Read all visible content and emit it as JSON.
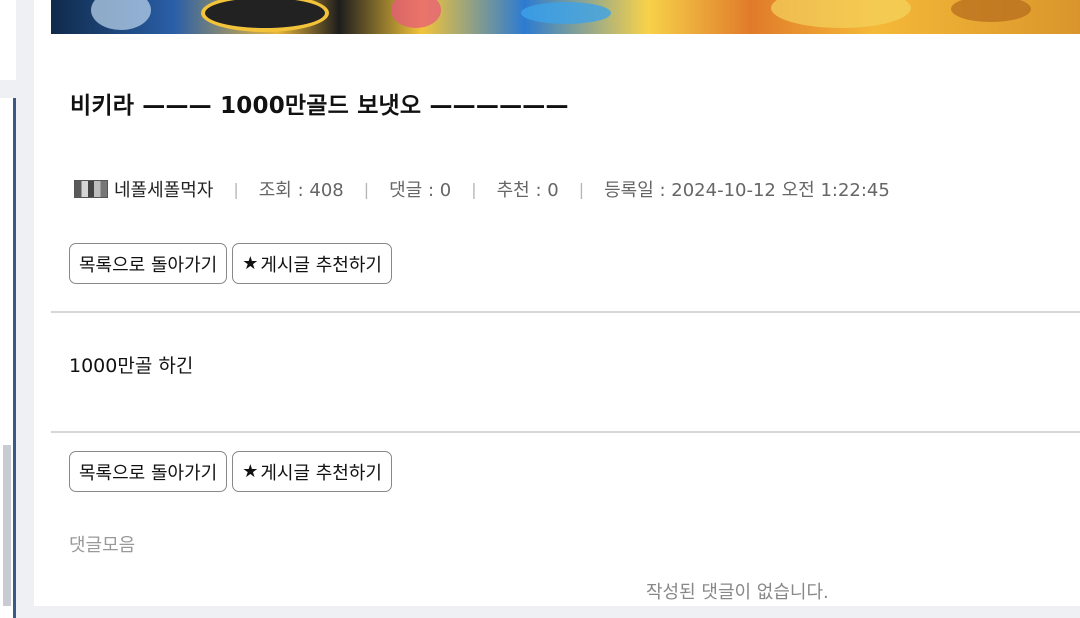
{
  "post": {
    "title": "비키라 ——— 1000만골드 보냇오 ——————",
    "author": "네폴세폴먹자",
    "views": "조회 : 408",
    "comments_count": "댓글 : 0",
    "recommends": "추천 : 0",
    "date": "등록일 : 2024-10-12 오전 1:22:45",
    "body": "1000만골 하긴"
  },
  "buttons": {
    "back_to_list": "목록으로 돌아가기",
    "recommend": "게시글 추천하기"
  },
  "icons": {
    "recommend": "star-icon",
    "author": "author-badge-icon"
  },
  "comments": {
    "heading": "댓글모음",
    "empty": "작성된 댓글이 없습니다."
  }
}
